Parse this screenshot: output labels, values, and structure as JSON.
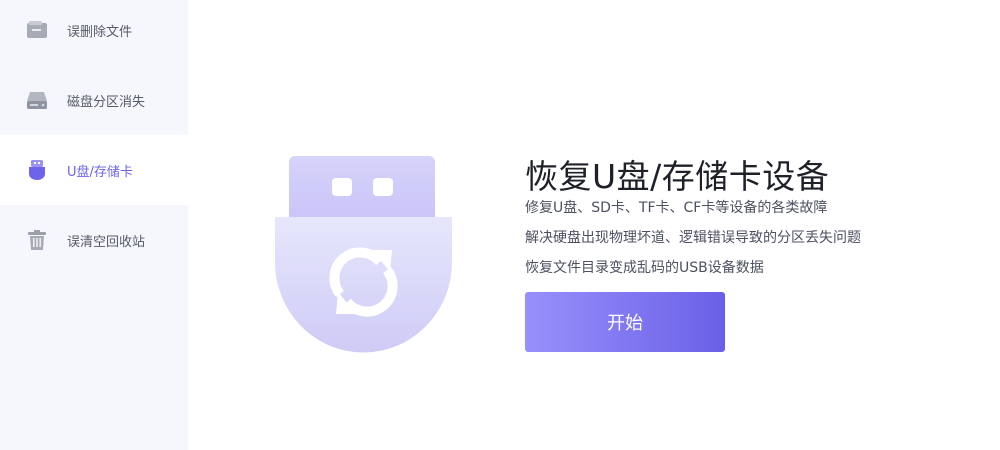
{
  "sidebar": {
    "items": [
      {
        "label": "误删除文件",
        "icon": "folder-icon"
      },
      {
        "label": "磁盘分区消失",
        "icon": "hard-drive-icon"
      },
      {
        "label": "U盘/存储卡",
        "icon": "usb-drive-icon",
        "active": true
      },
      {
        "label": "误清空回收站",
        "icon": "trash-icon"
      }
    ]
  },
  "main": {
    "illustration_icon": "usb-refresh-icon",
    "title": "恢复U盘/存储卡设备",
    "descriptions": [
      "修复U盘、SD卡、TF卡、CF卡等设备的各类故障",
      "解决硬盘出现物理坏道、逻辑错误导致的分区丢失问题",
      "恢复文件目录变成乱码的USB设备数据"
    ],
    "start_button": "开始"
  },
  "colors": {
    "accent": "#6b62e6",
    "sidebar_bg": "#f5f7fd",
    "button_gradient_start": "#9890fb",
    "button_gradient_end": "#6a60e8"
  }
}
